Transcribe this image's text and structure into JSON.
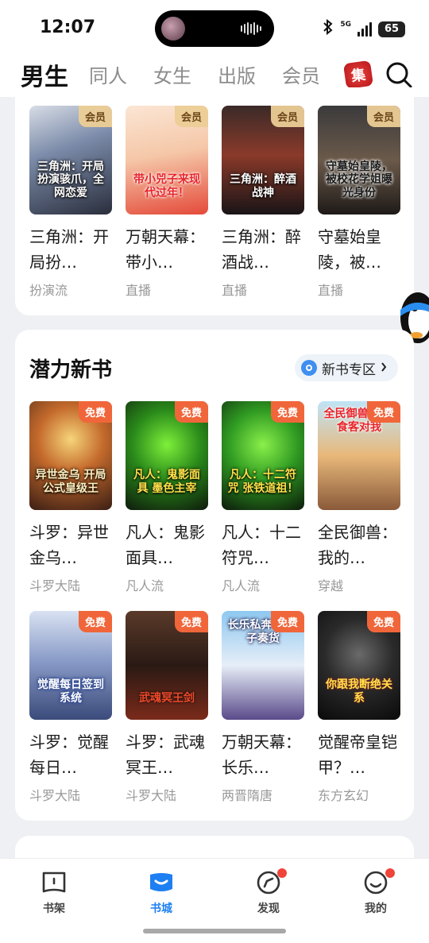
{
  "status": {
    "time": "12:07",
    "network": "5G",
    "battery": "65"
  },
  "top_tabs": [
    {
      "label": "男生",
      "active": true
    },
    {
      "label": "同人"
    },
    {
      "label": "女生"
    },
    {
      "label": "出版"
    },
    {
      "label": "会员"
    }
  ],
  "collection_badge": "集",
  "member_row": [
    {
      "tag": "会员",
      "title": "三角洲：开局扮…",
      "category": "扮演流",
      "cover_text": "三角洲：开局扮演骇爪，全网恋爱"
    },
    {
      "tag": "会员",
      "title": "万朝天幕：带小…",
      "category": "直播",
      "cover_text": "带小兕子来现代过年！"
    },
    {
      "tag": "会员",
      "title": "三角洲：醉酒战…",
      "category": "直播",
      "cover_text": "三角洲：醉酒战神"
    },
    {
      "tag": "会员",
      "title": "守墓始皇陵，被…",
      "category": "直播",
      "cover_text": "守墓始皇陵，被校花学姐曝光身份"
    }
  ],
  "potential_section": {
    "title": "潜力新书",
    "zone_link": "新书专区",
    "books": [
      {
        "tag": "免费",
        "title": "斗罗：异世金乌…",
        "category": "斗罗大陆",
        "cover_text": "异世金乌 开局公式皇级王"
      },
      {
        "tag": "免费",
        "title": "凡人：鬼影面具…",
        "category": "凡人流",
        "cover_text": "凡人：鬼影面具 墨色主宰"
      },
      {
        "tag": "免费",
        "title": "凡人：十二符咒…",
        "category": "凡人流",
        "cover_text": "凡人：十二符咒 张铁道祖！"
      },
      {
        "tag": "免费",
        "title": "全民御兽：我的…",
        "category": "穿越",
        "cover_text": "全民御兽 我的食客对我"
      },
      {
        "tag": "免费",
        "title": "斗罗：觉醒每日…",
        "category": "斗罗大陆",
        "cover_text": "觉醒每日签到系统"
      },
      {
        "tag": "免费",
        "title": "斗罗：武魂冥王…",
        "category": "斗罗大陆",
        "cover_text": "武魂冥王剑"
      },
      {
        "tag": "免费",
        "title": "万朝天幕：长乐…",
        "category": "两晋隋唐",
        "cover_text": "长乐私奔 小兕子奏货"
      },
      {
        "tag": "免费",
        "title": "觉醒帝皇铠甲？…",
        "category": "东方玄幻",
        "cover_text": "你跟我断绝关系"
      }
    ]
  },
  "bottom_nav": [
    {
      "label": "书架",
      "icon": "bookshelf-icon"
    },
    {
      "label": "书城",
      "icon": "bookstore-icon",
      "active": true
    },
    {
      "label": "发现",
      "icon": "discover-icon",
      "dot": true
    },
    {
      "label": "我的",
      "icon": "profile-icon",
      "dot": true
    }
  ],
  "colors": {
    "accent": "#1d7ff2",
    "free_tag": "#f0663a",
    "member_tag": "#eccd96",
    "badge_dot": "#f0443a"
  }
}
